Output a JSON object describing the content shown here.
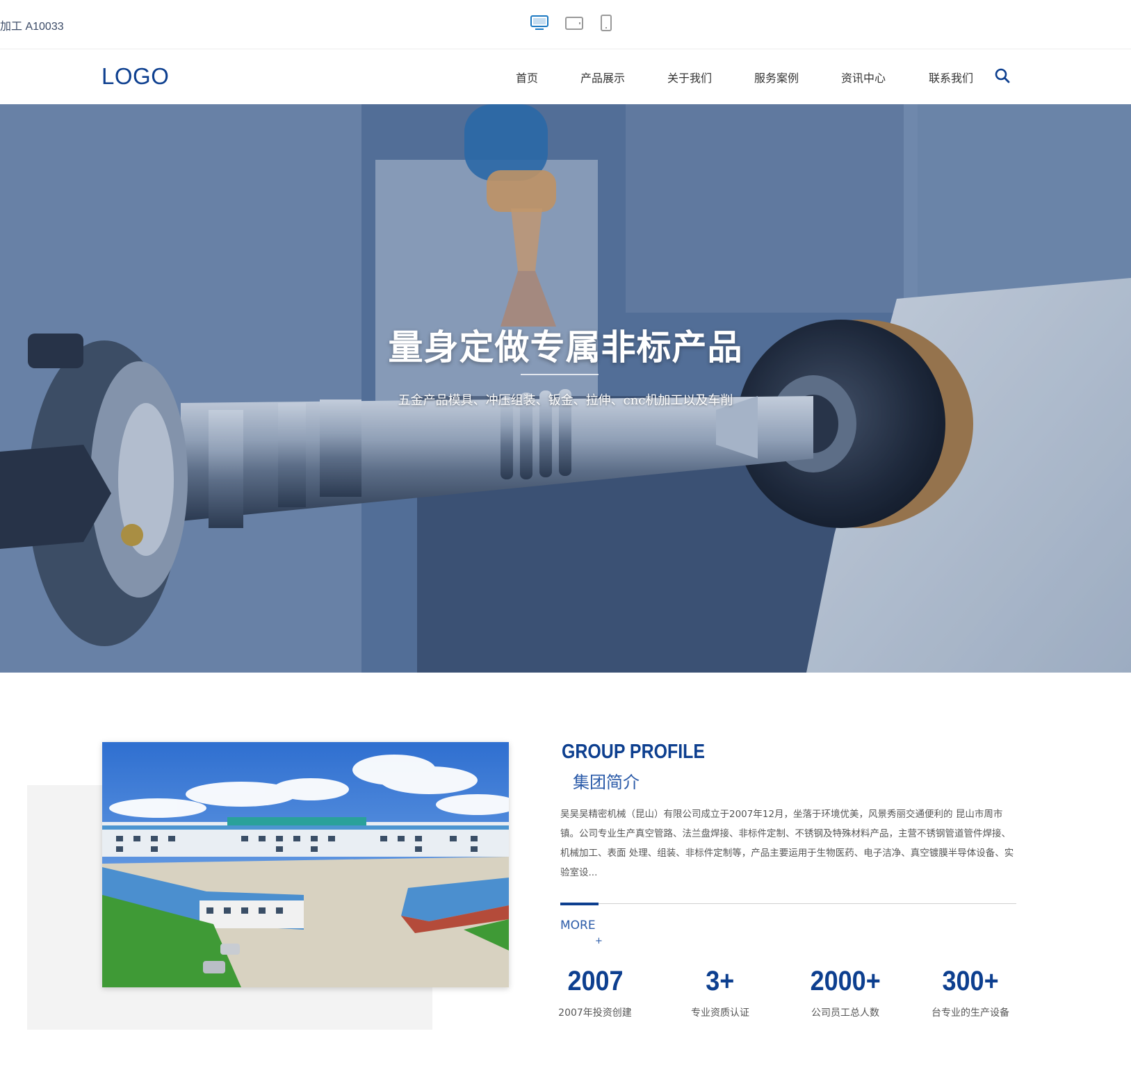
{
  "topbar": {
    "label": "加工   A10033",
    "devices": [
      {
        "name": "desktop",
        "active": true
      },
      {
        "name": "tablet",
        "active": false
      },
      {
        "name": "mobile",
        "active": false
      }
    ],
    "active_color": "#1a78c2"
  },
  "nav": {
    "logo": "LOGO",
    "items": [
      "首页",
      "产品展示",
      "关于我们",
      "服务案例",
      "资讯中心",
      "联系我们"
    ],
    "search_icon": "search-icon"
  },
  "hero": {
    "title": "量身定做专属非标产品",
    "subtitle": "五金产品模具、冲压组装、钣金、拉伸、cnc机加工以及车削"
  },
  "profile": {
    "en_title": "GROUP PROFILE",
    "cn_title": "集团简介",
    "intro": "吴吴吴精密机械（昆山）有限公司成立于2007年12月，坐落于环境优美，风景秀丽交通便利的 昆山市周市镇。公司专业生产真空管路、法兰盘焊接、非标件定制、不锈钢及特殊材料产品，主营不锈钢管道管件焊接、机械加工、表面 处理、组装、非标件定制等，产品主要运用于生物医药、电子洁净、真空镀膜半导体设备、实验室设...",
    "more_label": "MORE",
    "more_icon": "+",
    "stats": [
      {
        "value": "2007",
        "label": "2007年投资创建"
      },
      {
        "value": "3+",
        "label": "专业资质认证"
      },
      {
        "value": "2000+",
        "label": "公司员工总人数"
      },
      {
        "value": "300+",
        "label": "台专业的生产设备"
      }
    ]
  },
  "colors": {
    "brand": "#0d3f8f",
    "accent": "#2a5aa8"
  }
}
